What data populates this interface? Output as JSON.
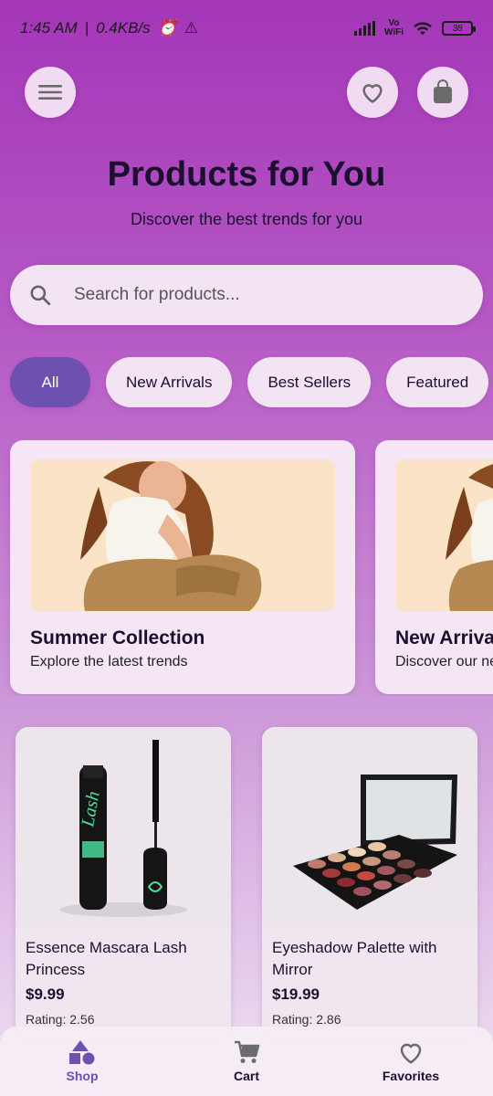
{
  "status_bar": {
    "time": "1:45 AM",
    "speed": "0.4KB/s",
    "vowifi_top": "Vo",
    "vowifi_bottom": "WiFi",
    "battery": "38"
  },
  "header": {
    "title": "Products for You",
    "subtitle": "Discover the best trends for you"
  },
  "search": {
    "placeholder": "Search for products..."
  },
  "chips": [
    {
      "label": "All",
      "active": true
    },
    {
      "label": "New Arrivals"
    },
    {
      "label": "Best Sellers"
    },
    {
      "label": "Featured"
    }
  ],
  "promos": [
    {
      "title": "Summer Collection",
      "subtitle": "Explore the latest trends"
    },
    {
      "title": "New Arrivals",
      "subtitle": "Discover our new collection"
    }
  ],
  "products": [
    {
      "name": "Essence Mascara Lash Princess",
      "price": "$9.99",
      "rating": "Rating: 2.56"
    },
    {
      "name": "Eyeshadow Palette with Mirror",
      "price": "$19.99",
      "rating": "Rating: 2.86"
    }
  ],
  "bottom_nav": [
    {
      "label": "Shop",
      "icon": "shapes-icon",
      "active": true
    },
    {
      "label": "Cart",
      "icon": "cart-icon"
    },
    {
      "label": "Favorites",
      "icon": "heart-icon"
    }
  ],
  "colors": {
    "accent": "#6d50b0",
    "background_top": "#a436b8",
    "card": "#f4e6f4"
  }
}
